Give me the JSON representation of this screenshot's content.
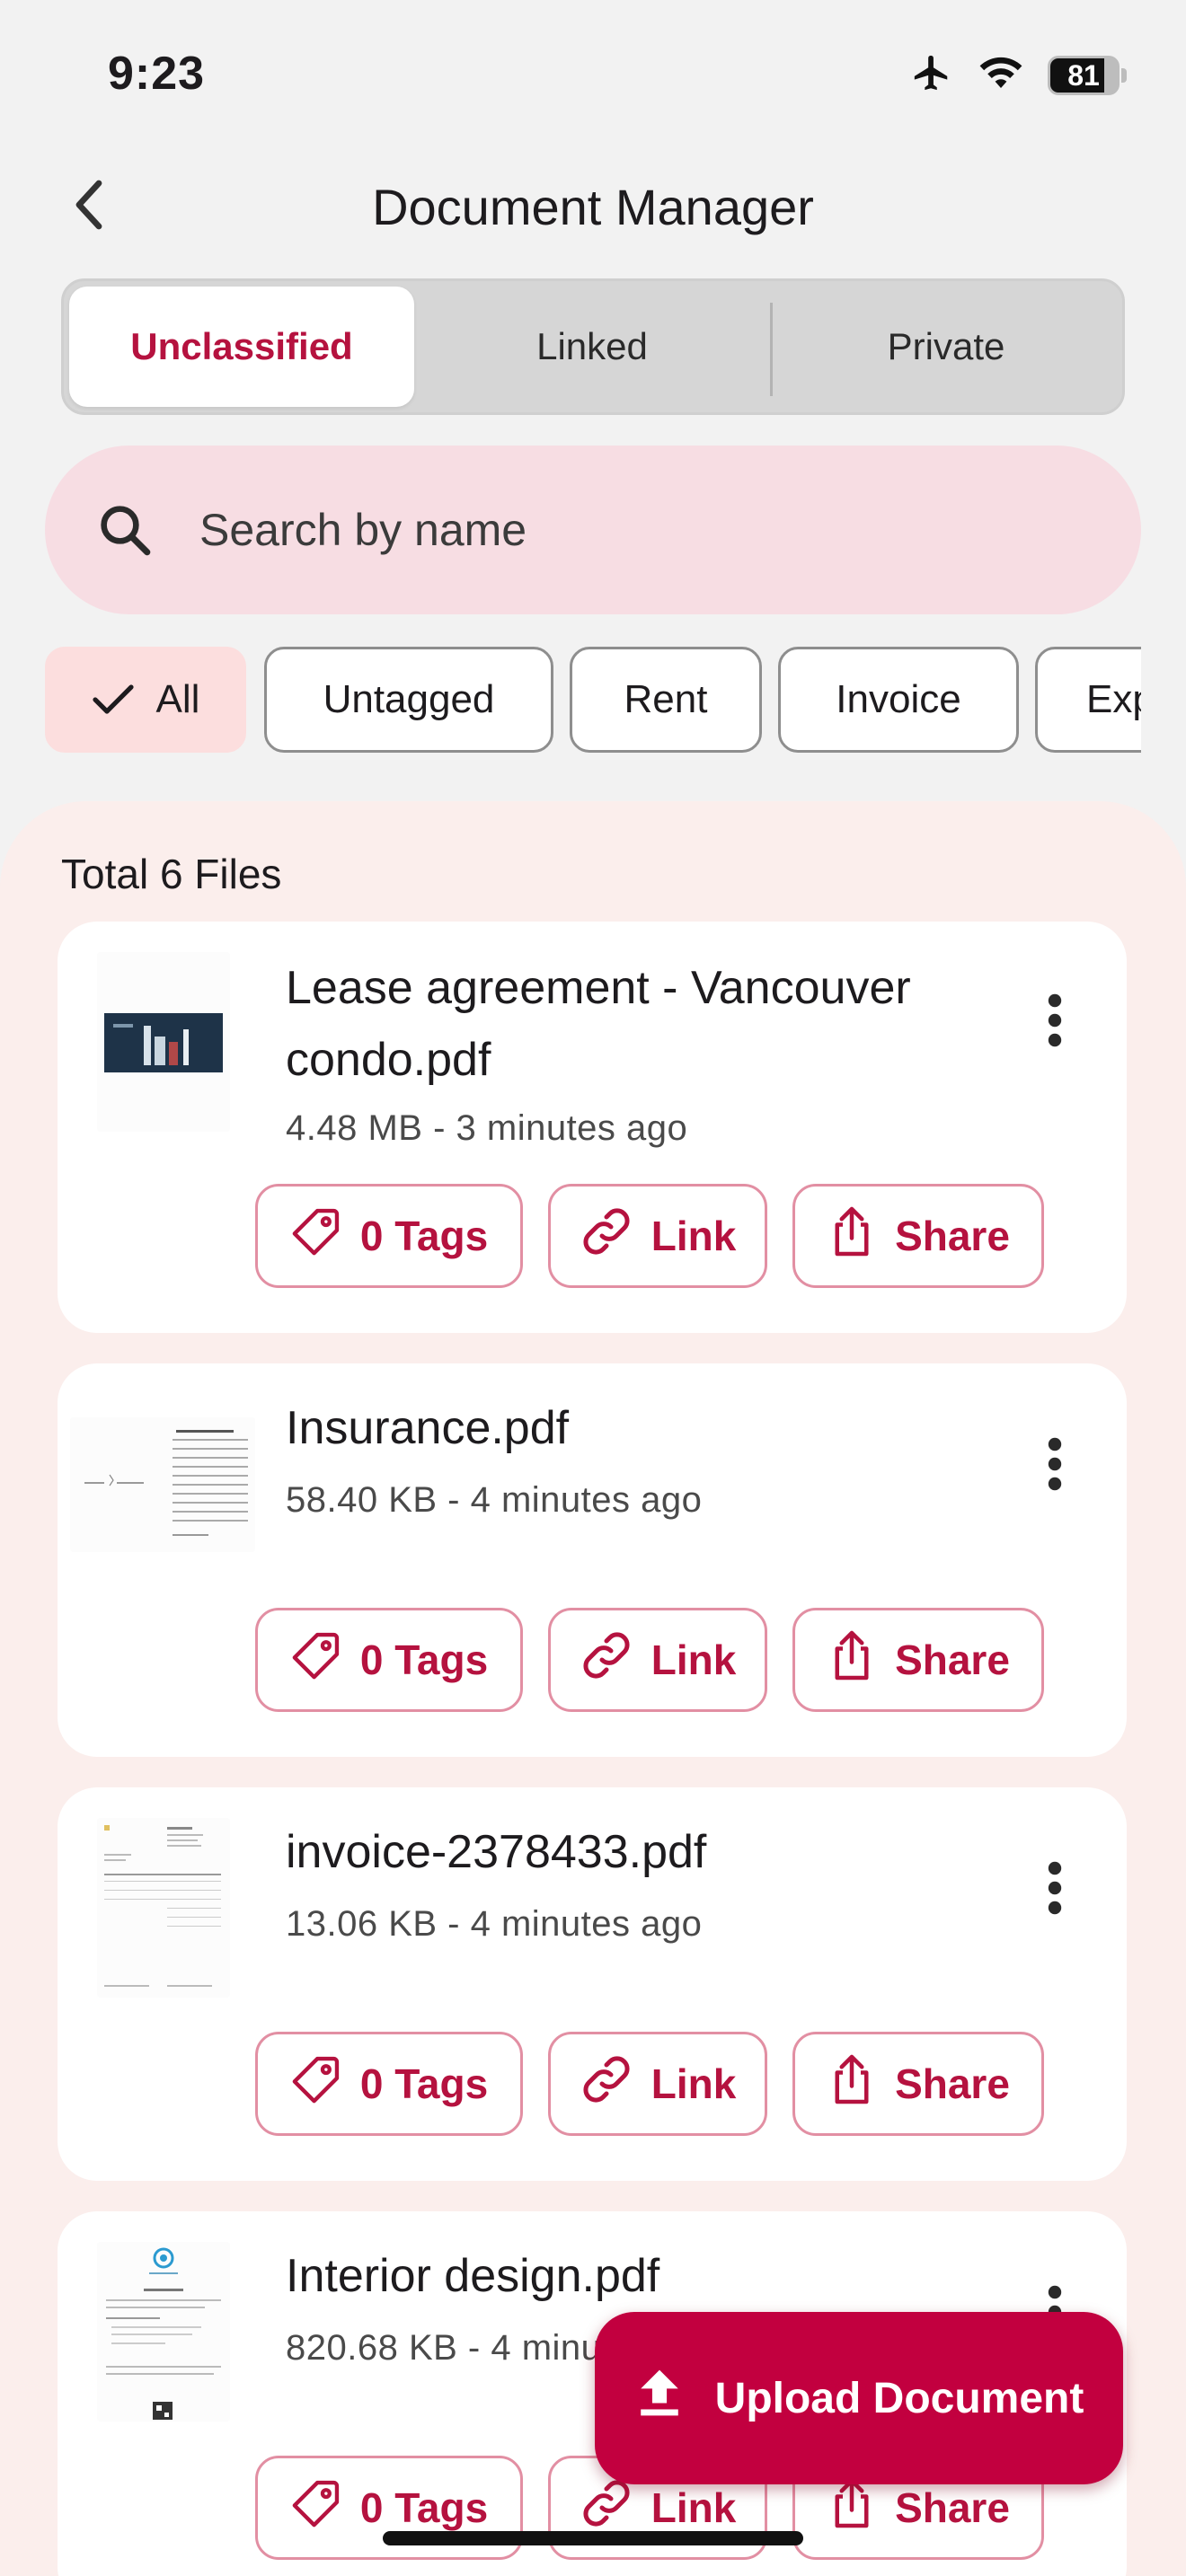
{
  "status_bar": {
    "time": "9:23",
    "battery": "81",
    "battery_level": 0.81
  },
  "header": {
    "title": "Document Manager"
  },
  "tabs": [
    {
      "label": "Unclassified",
      "active": true
    },
    {
      "label": "Linked",
      "active": false
    },
    {
      "label": "Private",
      "active": false
    }
  ],
  "search": {
    "placeholder": "Search by name",
    "value": ""
  },
  "filters": [
    {
      "label": "All",
      "active": true
    },
    {
      "label": "Untagged",
      "active": false
    },
    {
      "label": "Rent",
      "active": false
    },
    {
      "label": "Invoice",
      "active": false
    },
    {
      "label": "Exp",
      "active": false
    }
  ],
  "files_summary": "Total 6 Files",
  "files": [
    {
      "name_line1": "Lease agreement - Vancouver",
      "name_line2": "condo.pdf",
      "meta": "4.48 MB - 3 minutes ago",
      "tags": "0 Tags",
      "link": "Link",
      "share": "Share"
    },
    {
      "name_line1": "Insurance.pdf",
      "name_line2": "",
      "meta": "58.40 KB - 4 minutes ago",
      "tags": "0 Tags",
      "link": "Link",
      "share": "Share"
    },
    {
      "name_line1": "invoice-2378433.pdf",
      "name_line2": "",
      "meta": "13.06 KB - 4 minutes ago",
      "tags": "0 Tags",
      "link": "Link",
      "share": "Share"
    },
    {
      "name_line1": "Interior design.pdf",
      "name_line2": "",
      "meta": "820.68 KB - 4 minu",
      "tags": "0 Tags",
      "link": "Link",
      "share": "Share"
    }
  ],
  "fab": {
    "label": "Upload Document"
  },
  "colors": {
    "accent": "#c2003f",
    "accent_text": "#b5123f",
    "search_bg": "#f7dde3",
    "panel_bg": "#fbeeec",
    "chip_active_bg": "#fcdede"
  },
  "icons": {
    "back": "chevron-left-icon",
    "search": "search-icon",
    "check": "check-icon",
    "tag": "tag-icon",
    "link": "link-icon",
    "share": "share-icon",
    "more": "more-vertical-icon",
    "upload": "upload-icon"
  }
}
